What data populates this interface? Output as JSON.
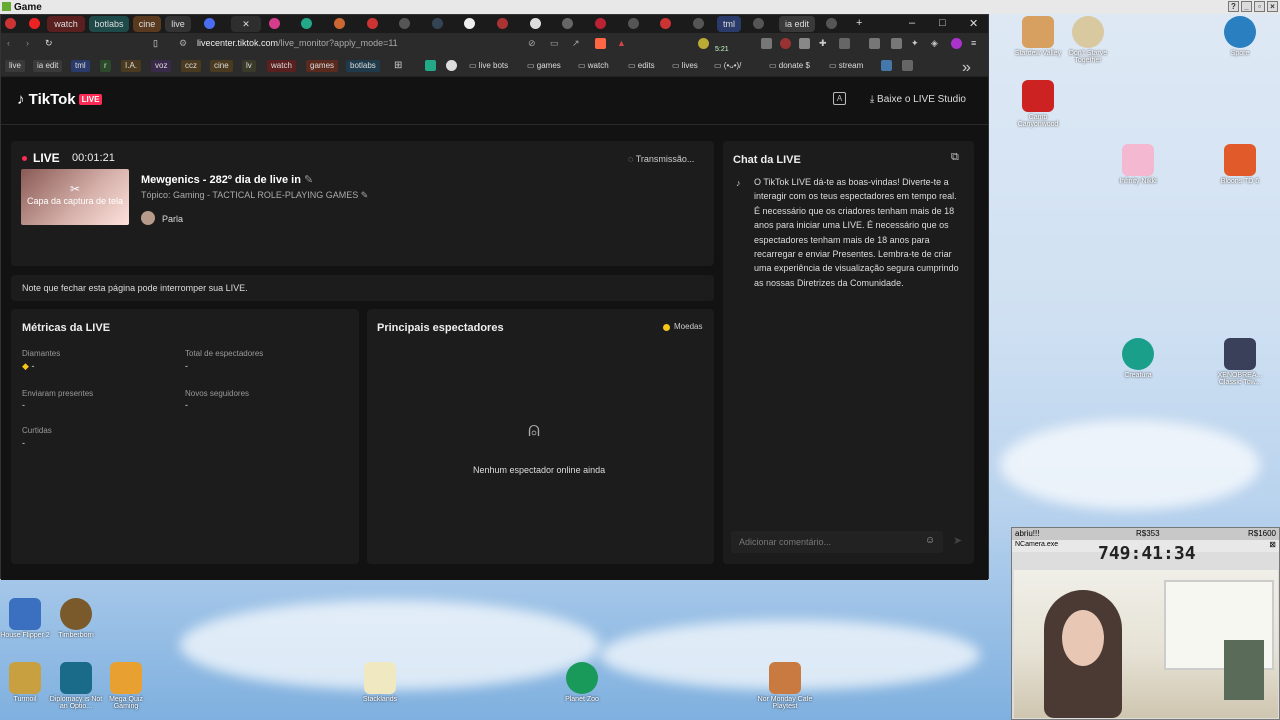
{
  "os": {
    "window_title": "Game"
  },
  "browser": {
    "tabs": [
      "watch",
      "botlabs",
      "cine",
      "live",
      "tml",
      "ia edit"
    ],
    "url_host": "livecenter.tiktok.com",
    "url_path": "/live_monitor?apply_mode=11",
    "ext_counter": "5:21",
    "bookmarks_chips": [
      "live",
      "ia edit",
      "tml",
      "r",
      "I.A.",
      "voz",
      "ccz",
      "cine",
      "lv",
      "watch",
      "games",
      "botlabs"
    ],
    "bookmarks_folders": [
      "live bots",
      "games",
      "watch",
      "edits",
      "lives",
      "(•ᴗ•)/",
      "donate $",
      "stream"
    ]
  },
  "tiktok": {
    "logo": "TikTok",
    "logo_badge": "LIVE",
    "studio_link": "Baixe o LIVE Studio",
    "status": {
      "label": "LIVE",
      "timer": "00:01:21",
      "transmission": "Transmissão..."
    },
    "stream": {
      "thumb_caption": "Capa da captura de tela",
      "title": "Mewgenics - 282º dia de live in",
      "topic": "Tópico: Gaming - TACTICAL ROLE-PLAYING GAMES",
      "host": "Parla"
    },
    "notice": "Note que fechar esta página pode interromper sua LIVE.",
    "metrics": {
      "title": "Métricas da LIVE",
      "items": [
        {
          "label": "Diamantes",
          "value": "-"
        },
        {
          "label": "Total de espectadores",
          "value": "-"
        },
        {
          "label": "Enviaram presentes",
          "value": "-"
        },
        {
          "label": "Novos seguidores",
          "value": "-"
        },
        {
          "label": "Curtidas",
          "value": "-"
        }
      ]
    },
    "viewers": {
      "title": "Principais espectadores",
      "legend": "Moedas",
      "empty": "Nenhum espectador online ainda"
    },
    "chat": {
      "title": "Chat da LIVE",
      "welcome": "O TikTok LIVE dá-te as boas-vindas! Diverte-te a interagir com os teus espectadores em tempo real. É necessário que os criadores tenham mais de 18 anos para iniciar uma LIVE. É necessário que os espectadores tenham mais de 18 anos para recarregar e enviar Presentes. Lembra-te de criar uma experiência de visualização segura cumprindo as nossas Diretrizes da Comunidade.",
      "input_placeholder": "Adicionar comentário..."
    }
  },
  "desktop": {
    "icons": [
      "Stardew Valley",
      "Don't Starve Together",
      "Spore",
      "Camp Canyonwood",
      "Infinity Nikki",
      "Bloons TD 6",
      "Creatura",
      "XENOBREA... Classic Tow...",
      "House Flipper 2",
      "Timberborn",
      "Turmoil",
      "Diplomacy is Not an Optio...",
      "Mega Quiz Gaming",
      "Stacklands",
      "Planet Zoo",
      "Nor Monday Cafe Playtest"
    ]
  },
  "cam": {
    "label1": "abriu!!!",
    "value1": "R$353",
    "value2": "R$1600",
    "app": "NCamera.exe",
    "counter": "749:41:34"
  }
}
